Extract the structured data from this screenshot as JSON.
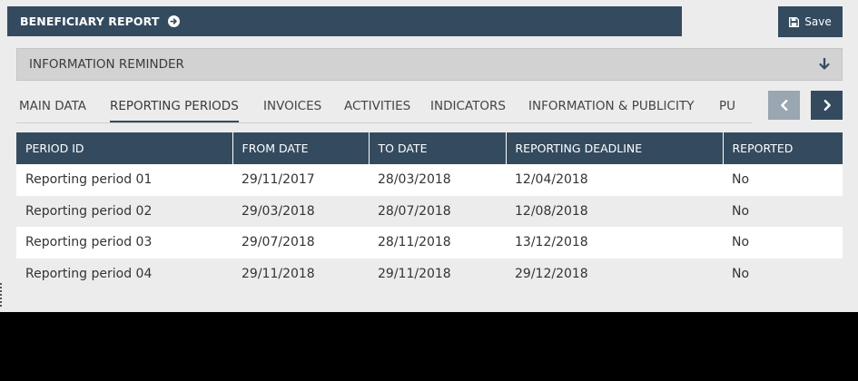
{
  "header": {
    "title": "BENEFICIARY REPORT",
    "title_icon": "arrow-circle-right-icon",
    "save_label": "Save",
    "save_icon": "floppy-disk-icon"
  },
  "reminder": {
    "label": "INFORMATION REMINDER",
    "icon": "arrow-down-icon"
  },
  "tabs": [
    {
      "label": "MAIN DATA",
      "active": false
    },
    {
      "label": "REPORTING PERIODS",
      "active": true
    },
    {
      "label": "INVOICES",
      "active": false
    },
    {
      "label": "ACTIVITIES",
      "active": false
    },
    {
      "label": "INDICATORS",
      "active": false
    },
    {
      "label": "INFORMATION & PUBLICITY",
      "active": false
    },
    {
      "label": "PU",
      "active": false
    }
  ],
  "table": {
    "columns": [
      "PERIOD ID",
      "FROM DATE",
      "TO DATE",
      "REPORTING DEADLINE",
      "REPORTED"
    ],
    "rows": [
      [
        "Reporting period 01",
        "29/11/2017",
        "28/03/2018",
        "12/04/2018",
        "No"
      ],
      [
        "Reporting period 02",
        "29/03/2018",
        "28/07/2018",
        "12/08/2018",
        "No"
      ],
      [
        "Reporting period 03",
        "29/07/2018",
        "28/11/2018",
        "13/12/2018",
        "No"
      ],
      [
        "Reporting period 04",
        "29/11/2018",
        "29/11/2018",
        "29/12/2018",
        "No"
      ]
    ]
  },
  "colors": {
    "primary": "#344b5f",
    "disabled_nav": "#9aa6b1",
    "panel_bg": "#ececec",
    "reminder_bg": "#d2d2d2"
  }
}
